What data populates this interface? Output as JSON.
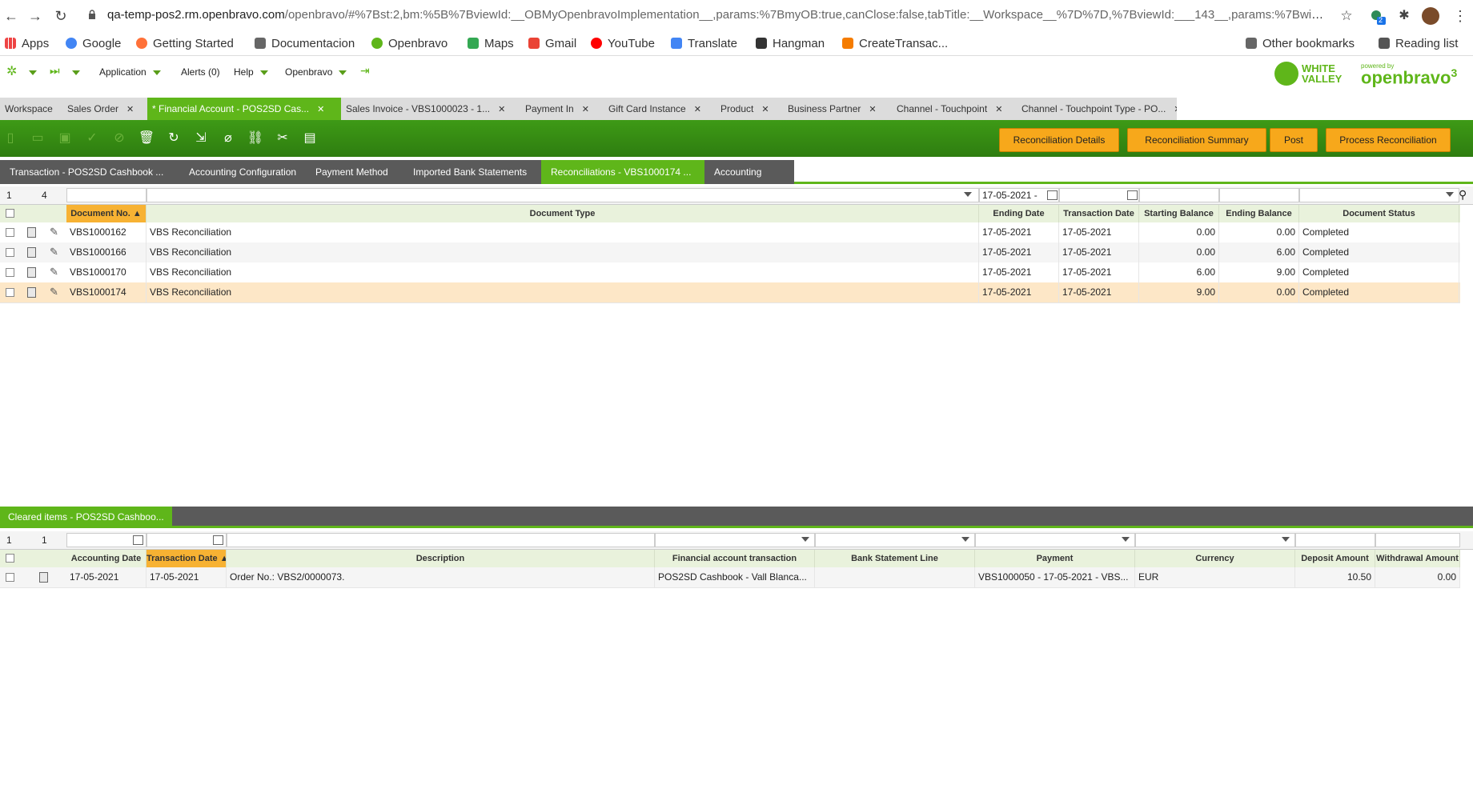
{
  "browser": {
    "url_host": "qa-temp-pos2.rm.openbravo.com",
    "url_path": "/openbravo/#%7Bst:2,bm:%5B%7BviewId:__OBMyOpenbravoImplementation__,params:%7BmyOB:true,canClose:false,tabTitle:__Workspace__%7D%7D,%7BviewId:___143__,params:%7BwindowId:__143__,v...",
    "extension_badge": "2",
    "bookmarks": [
      "Apps",
      "Google",
      "Getting Started",
      "Documentacion",
      "Openbravo",
      "Maps",
      "Gmail",
      "YouTube",
      "Translate",
      "Hangman",
      "CreateTransac..."
    ],
    "other_bookmarks": "Other bookmarks",
    "reading_list": "Reading list"
  },
  "topnav": {
    "application": "Application",
    "alerts": "Alerts (0)",
    "help": "Help",
    "openbravo": "Openbravo",
    "logo_wv_1": "WHITE",
    "logo_wv_2": "VALLEY",
    "logo_powered": "powered by",
    "logo_ob": "openbravo",
    "logo_ob_num": "3"
  },
  "main_tabs": [
    {
      "label": "Workspace",
      "closable": false
    },
    {
      "label": "Sales Order",
      "closable": true
    },
    {
      "label": "* Financial Account - POS2SD Cas...",
      "closable": true
    },
    {
      "label": "Sales Invoice - VBS1000023 - 1...",
      "closable": true
    },
    {
      "label": "Payment In",
      "closable": true
    },
    {
      "label": "Gift Card Instance",
      "closable": true
    },
    {
      "label": "Product",
      "closable": true
    },
    {
      "label": "Business Partner",
      "closable": true
    },
    {
      "label": "Channel - Touchpoint",
      "closable": true
    },
    {
      "label": "Channel - Touchpoint Type - PO...",
      "closable": true
    }
  ],
  "toolbar_buttons": {
    "reconciliation_details": "Reconciliation Details",
    "reconciliation_summary": "Reconciliation Summary",
    "post": "Post",
    "process_reconciliation": "Process Reconciliation"
  },
  "sub_tabs": [
    "Transaction - POS2SD Cashbook ...",
    "Accounting Configuration",
    "Payment Method",
    "Imported Bank Statements",
    "Reconciliations - VBS1000174 ...",
    "Accounting"
  ],
  "recon_grid": {
    "selected_count": "1",
    "total_count": "4",
    "ending_date_filter": "17-05-2021 -",
    "columns": [
      "Document No.",
      "Document Type",
      "Ending Date",
      "Transaction Date",
      "Starting Balance",
      "Ending Balance",
      "Document Status"
    ],
    "sort_indicator": "▲",
    "rows": [
      {
        "doc_no": "VBS1000162",
        "doc_type": "VBS Reconciliation",
        "ending_date": "17-05-2021",
        "trx_date": "17-05-2021",
        "starting": "0.00",
        "ending": "0.00",
        "status": "Completed"
      },
      {
        "doc_no": "VBS1000166",
        "doc_type": "VBS Reconciliation",
        "ending_date": "17-05-2021",
        "trx_date": "17-05-2021",
        "starting": "0.00",
        "ending": "6.00",
        "status": "Completed"
      },
      {
        "doc_no": "VBS1000170",
        "doc_type": "VBS Reconciliation",
        "ending_date": "17-05-2021",
        "trx_date": "17-05-2021",
        "starting": "6.00",
        "ending": "9.00",
        "status": "Completed"
      },
      {
        "doc_no": "VBS1000174",
        "doc_type": "VBS Reconciliation",
        "ending_date": "17-05-2021",
        "trx_date": "17-05-2021",
        "starting": "9.00",
        "ending": "0.00",
        "status": "Completed"
      }
    ]
  },
  "cleared": {
    "tab_label": "Cleared items - POS2SD Cashboo...",
    "selected_count": "1",
    "total_count": "1",
    "columns": [
      "Accounting Date",
      "Transaction Date",
      "Description",
      "Financial account transaction",
      "Bank Statement Line",
      "Payment",
      "Currency",
      "Deposit Amount",
      "Withdrawal Amount"
    ],
    "sort_indicator": "▲",
    "rows": [
      {
        "acct_date": "17-05-2021",
        "trx_date": "17-05-2021",
        "description": "Order No.: VBS2/0000073.",
        "fin_trx": "POS2SD Cashbook - Vall Blanca...",
        "bank_line": "",
        "payment": "VBS1000050 - 17-05-2021 - VBS...",
        "currency": "EUR",
        "deposit": "10.50",
        "withdrawal": "0.00"
      }
    ]
  }
}
